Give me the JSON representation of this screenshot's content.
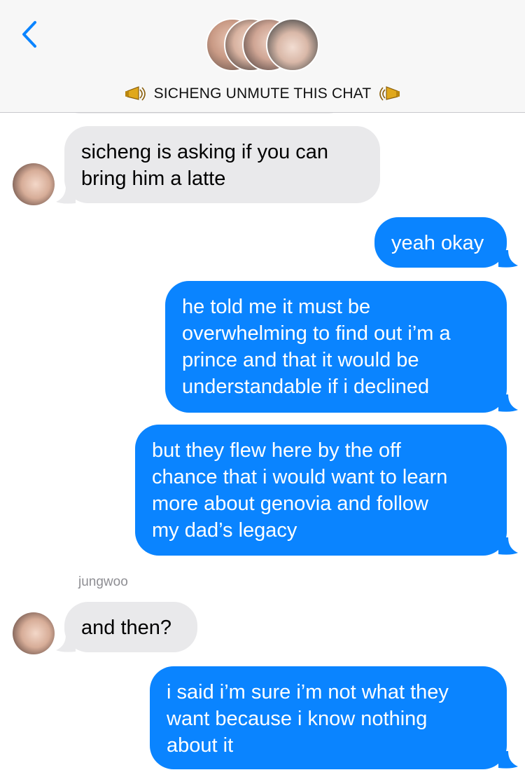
{
  "header": {
    "title": "SICHENG UNMUTE THIS CHAT",
    "back_icon": "chevron-left-icon",
    "accent": "#0a84ff",
    "group_avatars": [
      "member-1",
      "member-2",
      "member-3",
      "member-4"
    ]
  },
  "messages": [
    {
      "direction": "incoming",
      "lines": [
        "sicheng is asking if you can",
        "bring him a latte"
      ]
    },
    {
      "direction": "outgoing",
      "lines": [
        "yeah okay"
      ]
    },
    {
      "direction": "outgoing",
      "lines": [
        "he told me it must be",
        "overwhelming to find out i’m a",
        "prince and that it would be",
        "understandable if i declined"
      ]
    },
    {
      "direction": "outgoing",
      "lines": [
        "but they flew here by the off",
        "chance that i would want to learn",
        "more about genovia and follow",
        "my dad’s legacy"
      ]
    },
    {
      "direction": "incoming",
      "sender": "jungwoo",
      "lines": [
        "and then?"
      ]
    },
    {
      "direction": "outgoing",
      "lines": [
        "i said i’m sure i’m not what they",
        "want because i know nothing",
        "about it"
      ]
    }
  ],
  "colors": {
    "incoming_bubble": "#e9e9eb",
    "outgoing_bubble": "#0a84ff",
    "header_bg": "#f7f7f7",
    "sender_label": "#8e8e93"
  }
}
